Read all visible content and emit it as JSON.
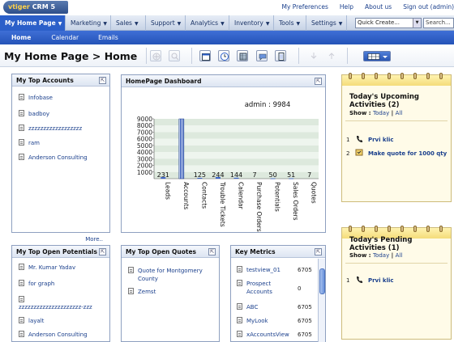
{
  "app": {
    "logo_brand": "vtiger",
    "logo_product": "CRM 5"
  },
  "top_links": [
    "My Preferences",
    "Help",
    "About us",
    "Sign out (admin)"
  ],
  "nav": {
    "tabs": [
      {
        "label": "My Home Page",
        "selected": true
      },
      {
        "label": "Marketing"
      },
      {
        "label": "Sales"
      },
      {
        "label": "Support"
      },
      {
        "label": "Analytics"
      },
      {
        "label": "Inventory"
      },
      {
        "label": "Tools"
      },
      {
        "label": "Settings"
      }
    ],
    "quick_create": "Quick Create...",
    "search_placeholder": "Search..."
  },
  "subnav": [
    "Home",
    "Calendar",
    "Emails"
  ],
  "page_title": "My Home Page > Home",
  "panels": {
    "top_accounts": {
      "title": "My Top Accounts",
      "items": [
        "Infobase",
        "badboy",
        "zzzzzzzzzzzzzzzzzz",
        "ram",
        "Anderson Consulting"
      ],
      "more": "More.."
    },
    "dashboard": {
      "title": "HomePage Dashboard"
    },
    "open_potentials": {
      "title": "My Top Open Potentials",
      "items": [
        "Mr. Kumar Yadav",
        "for graph",
        "zzzzzzzzzzzzzzzzzzzzz-zzz",
        "layalt",
        "Anderson Consulting"
      ]
    },
    "open_quotes": {
      "title": "My Top Open Quotes",
      "items": [
        "Quote for Montgomery County",
        "Zemst"
      ]
    },
    "key_metrics": {
      "title": "Key Metrics",
      "rows": [
        {
          "name": "testview_01",
          "value": "6705"
        },
        {
          "name": "Prospect Accounts",
          "value": "0"
        },
        {
          "name": "ABC",
          "value": "6705"
        },
        {
          "name": "MyLook",
          "value": "6705"
        },
        {
          "name": "xAccountsView",
          "value": "6705"
        }
      ]
    }
  },
  "upcoming": {
    "title": "Today's Upcoming Activities (2)",
    "show_label": "Show :",
    "today": "Today",
    "sep": "|",
    "all": "All",
    "items": [
      {
        "num": "1",
        "icon": "phone-icon",
        "text": "Prvi klic"
      },
      {
        "num": "2",
        "icon": "task-icon",
        "text": "Make quote for 1000 qty"
      }
    ]
  },
  "pending": {
    "title": "Today's Pending Activities (1)",
    "show_label": "Show :",
    "today": "Today",
    "sep": "|",
    "all": "All",
    "items": [
      {
        "num": "1",
        "icon": "phone-icon",
        "text": "Prvi klic"
      }
    ]
  },
  "chart_data": {
    "type": "bar",
    "title": "admin : 9984",
    "categories": [
      "Leads",
      "Accounts",
      "Contacts",
      "Trouble Tickets",
      "Calendar",
      "Purchase Orders",
      "Potentials",
      "Sales Orders",
      "Quotes"
    ],
    "values": [
      231,
      9984,
      125,
      244,
      144,
      7,
      50,
      51,
      7
    ],
    "value_labels": [
      "231",
      "",
      "125",
      "244",
      "144",
      "7",
      "50",
      "51",
      "7"
    ],
    "ylim": [
      0,
      9000
    ],
    "yticks": [
      "9000",
      "8000",
      "7000",
      "6000",
      "5000",
      "4000",
      "3000",
      "2000",
      "1000"
    ],
    "bar_color": "#3a63c8"
  }
}
